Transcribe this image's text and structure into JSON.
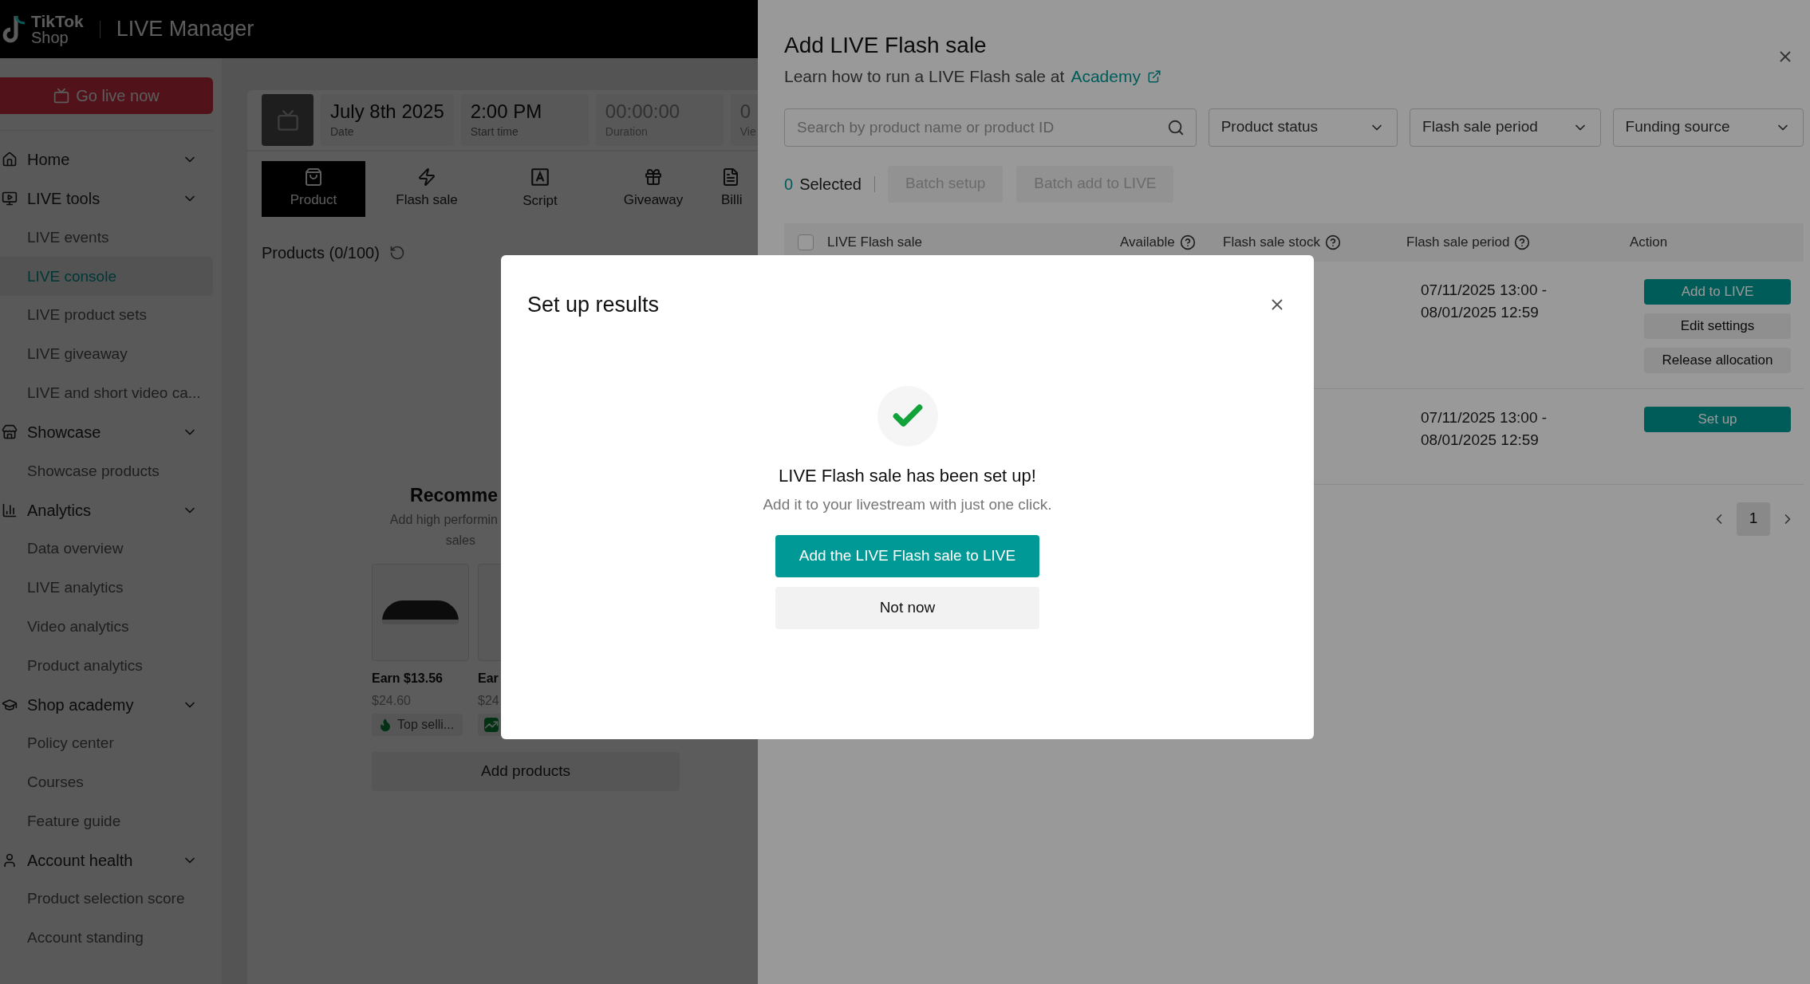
{
  "header": {
    "logo_line1": "TikTok",
    "logo_line2": "Shop",
    "title": "LIVE Manager"
  },
  "sidebar": {
    "go_live": "Go live now",
    "groups": [
      {
        "label": "Home"
      },
      {
        "label": "LIVE tools",
        "children": [
          {
            "label": "LIVE events",
            "selected": false
          },
          {
            "label": "LIVE console",
            "selected": true
          },
          {
            "label": "LIVE product sets",
            "selected": false
          },
          {
            "label": "LIVE giveaway",
            "selected": false
          },
          {
            "label": "LIVE and short video ca...",
            "selected": false
          }
        ]
      },
      {
        "label": "Showcase",
        "children": [
          {
            "label": "Showcase products",
            "selected": false
          }
        ]
      },
      {
        "label": "Analytics",
        "children": [
          {
            "label": "Data overview",
            "selected": false
          },
          {
            "label": "LIVE analytics",
            "selected": false
          },
          {
            "label": "Video analytics",
            "selected": false
          },
          {
            "label": "Product analytics",
            "selected": false
          }
        ]
      },
      {
        "label": "Shop academy",
        "children": [
          {
            "label": "Policy center",
            "selected": false
          },
          {
            "label": "Courses",
            "selected": false
          },
          {
            "label": "Feature guide",
            "selected": false
          }
        ]
      },
      {
        "label": "Account health",
        "children": [
          {
            "label": "Product selection score",
            "selected": false
          },
          {
            "label": "Account standing",
            "selected": false
          }
        ]
      }
    ]
  },
  "stats": [
    {
      "value": "July 8th 2025",
      "label": "Date",
      "disabled": false
    },
    {
      "value": "2:00 PM",
      "label": "Start time",
      "disabled": false
    },
    {
      "value": "00:00:00",
      "label": "Duration",
      "disabled": true
    },
    {
      "value": "0",
      "label": "Vie",
      "disabled": true
    }
  ],
  "tabs": [
    {
      "label": "Product",
      "selected": true
    },
    {
      "label": "Flash sale",
      "selected": false
    },
    {
      "label": "Script",
      "selected": false
    },
    {
      "label": "Giveaway",
      "selected": false
    },
    {
      "label": "Billi",
      "selected": false
    }
  ],
  "products": {
    "title": "Products (0/100)",
    "recommend_title": "Recomme",
    "recommend_lines": [
      "Add high performin",
      "sales"
    ],
    "cards": [
      {
        "earn": "Earn $13.56",
        "price": "$24.60",
        "tag": "Top selli..."
      },
      {
        "earn": "Ear",
        "price": "$24"
      }
    ],
    "add_button": "Add products"
  },
  "drawer": {
    "title": "Add LIVE Flash sale",
    "subtitle": "Learn how to run a LIVE Flash sale at",
    "link": "Academy",
    "search": {
      "placeholder": "Search by product name or product ID"
    },
    "filters": [
      "Product status",
      "Flash sale period",
      "Funding source"
    ],
    "selected_count": "0",
    "selected_label": "Selected",
    "batch_buttons": [
      {
        "label": "Batch setup",
        "disabled": true
      },
      {
        "label": "Batch add to LIVE",
        "disabled": true
      }
    ],
    "header_checkbox": {
      "checked": false
    },
    "columns": [
      {
        "label": "LIVE Flash sale",
        "help": false
      },
      {
        "label": "Available",
        "help": true
      },
      {
        "label": "Flash sale stock",
        "help": true
      },
      {
        "label": "Flash sale period",
        "help": true
      },
      {
        "label": "Action",
        "help": false
      }
    ],
    "rows": [
      {
        "period_start": "07/11/2025 13:00 -",
        "period_end": "08/01/2025 12:59",
        "actions": [
          {
            "label": "Add to LIVE",
            "kind": "primary"
          },
          {
            "label": "Edit settings",
            "kind": "secondary"
          },
          {
            "label": "Release allocation",
            "kind": "secondary"
          }
        ]
      },
      {
        "period_start": "07/11/2025 13:00 -",
        "period_end": "08/01/2025 12:59",
        "actions": [
          {
            "label": "Set up",
            "kind": "primary"
          }
        ]
      }
    ],
    "pages": [
      {
        "label": "1",
        "selected": true
      }
    ]
  },
  "modal": {
    "title": "Set up results",
    "heading": "LIVE Flash sale has been set up!",
    "text": "Add it to your livestream with just one click.",
    "primary": "Add the LIVE Flash sale to LIVE",
    "secondary": "Not now"
  }
}
